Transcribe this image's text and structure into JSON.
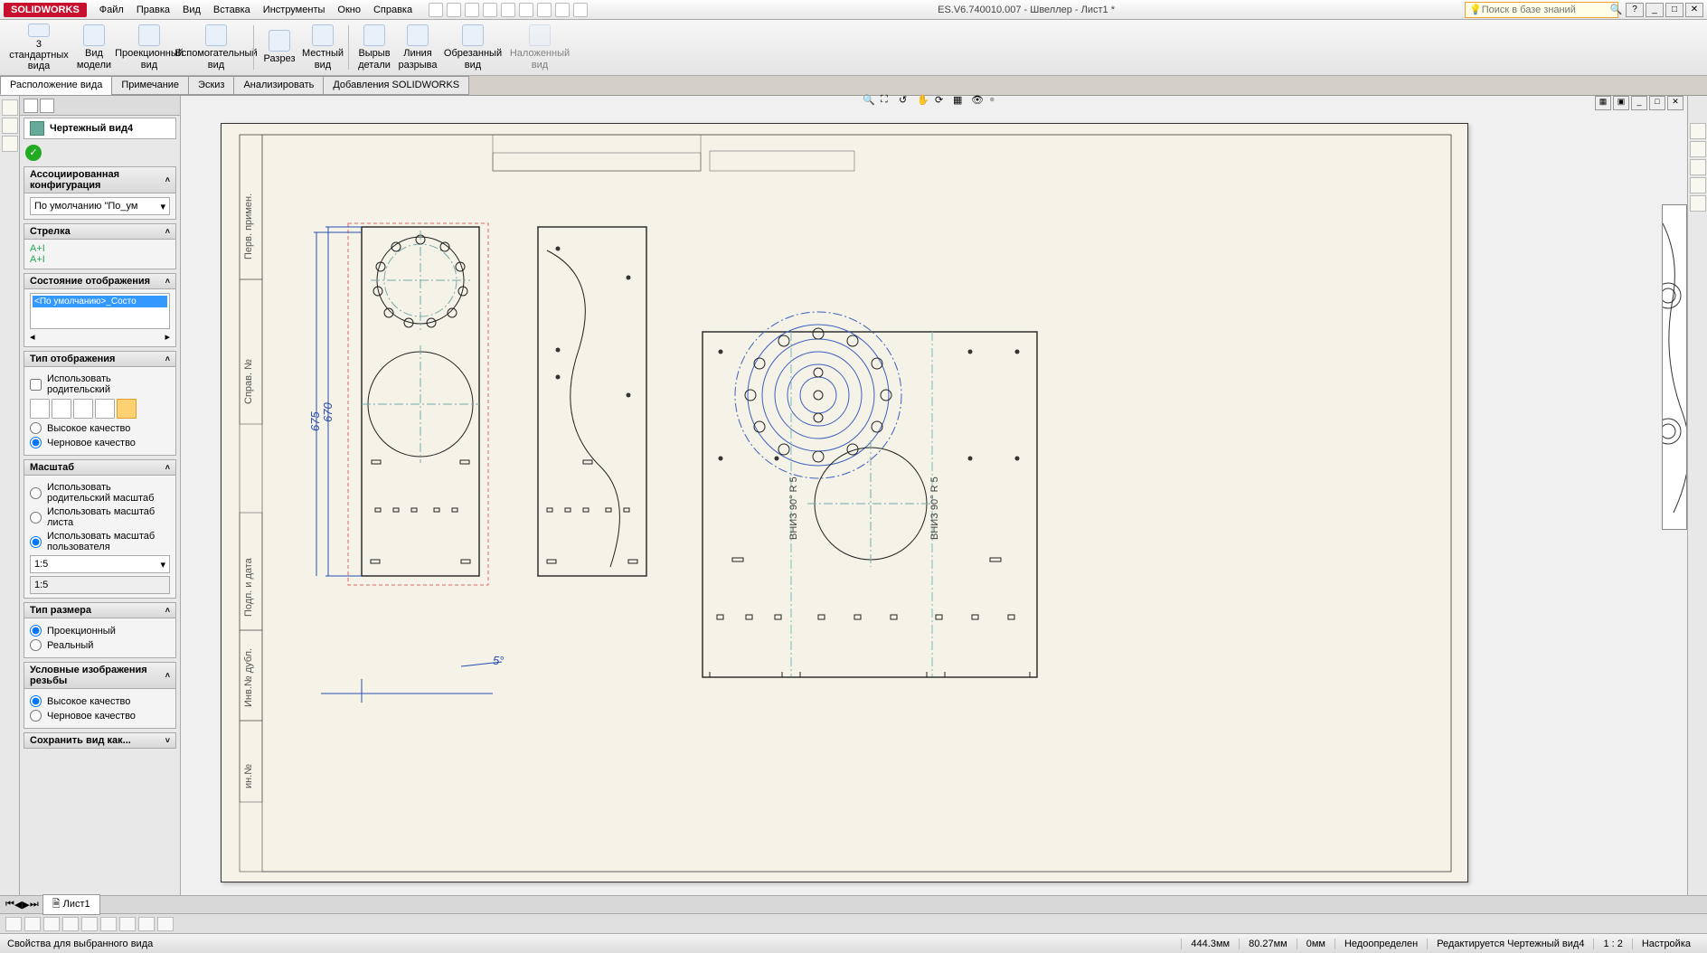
{
  "app": {
    "name": "SOLIDWORKS",
    "doc_title": "ES.V6.740010.007 - Швеллер - Лист1 *"
  },
  "menu": {
    "file": "Файл",
    "edit": "Правка",
    "view": "Вид",
    "insert": "Вставка",
    "tools": "Инструменты",
    "window": "Окно",
    "help": "Справка"
  },
  "search": {
    "placeholder": "Поиск в базе знаний"
  },
  "ribbon": {
    "std_views": "3\nстандартных\nвида",
    "model_view": "Вид модели",
    "proj_view": "Проекционный\nвид",
    "aux_view": "Вспомогательный\nвид",
    "section": "Разрез",
    "local": "Местный\nвид",
    "broken": "Вырыв\nдетали",
    "break": "Линия\nразрыва",
    "crop": "Обрезанный\nвид",
    "alt": "Наложенный\nвид"
  },
  "tabs": {
    "layout": "Расположение вида",
    "annot": "Примечание",
    "sketch": "Эскиз",
    "analyze": "Анализировать",
    "addins": "Добавления SOLIDWORKS"
  },
  "pm": {
    "title": "Чертежный вид4",
    "assoc_cfg": "Ассоциированная конфигурация",
    "cfg_value": "По умолчанию \"По_ум",
    "arrow": "Стрелка",
    "arrow_a": "A+I",
    "arrow_b": "A+I",
    "disp_state": "Состояние отображения",
    "ds_value": "<По умолчанию>_Состо",
    "disp_type": "Тип отображения",
    "use_parent": "Использовать родительский",
    "hq": "Высокое качество",
    "draft": "Черновое качество",
    "scale": "Масштаб",
    "use_parent_scale": "Использовать родительский масштаб",
    "use_sheet_scale": "Использовать масштаб листа",
    "use_user_scale": "Использовать масштаб пользователя",
    "scale_ratio": "1:5",
    "scale_custom": "1:5",
    "dim_type": "Тип размера",
    "projected": "Проекционный",
    "real": "Реальный",
    "thread": "Условные изображения резьбы",
    "thread_hq": "Высокое качество",
    "thread_draft": "Черновое качество",
    "save_as": "Сохранить вид как..."
  },
  "sheet_tab": "Лист1",
  "drawing": {
    "dim1": "675",
    "dim2": "670",
    "angle": "5°",
    "note1": "ВНИЗ  90°  R 5",
    "note2": "ВНИЗ  90°  R 5",
    "sidelabels": [
      "Перв. примен.",
      "Справ. №",
      "Подп. и дата",
      "Инв.№ дубл.",
      "ин.№"
    ]
  },
  "status": {
    "hint": "Свойства для выбранного вида",
    "x": "444.3мм",
    "y": "80.27мм",
    "z": "0мм",
    "def": "Недоопределен",
    "edit": "Редактируется Чертежный вид4",
    "ratio": "1 : 2",
    "cfg": "Настройка"
  }
}
